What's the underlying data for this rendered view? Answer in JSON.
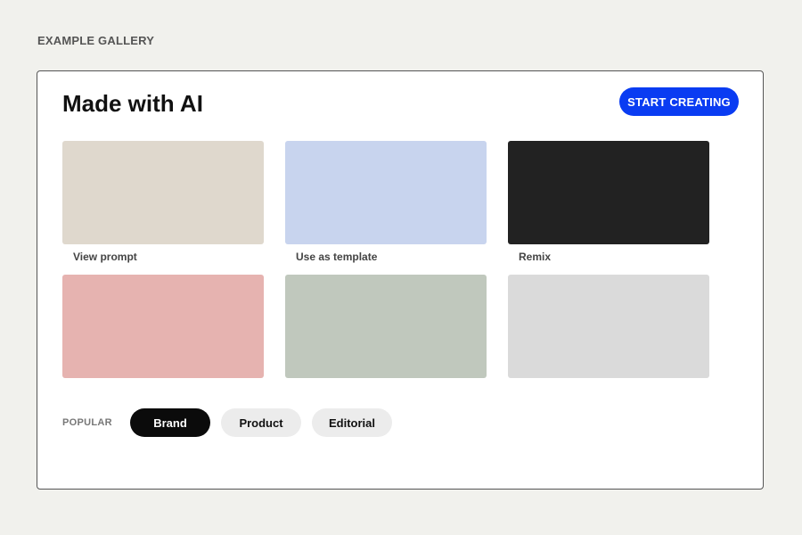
{
  "header": {
    "eyebrow": "EXAMPLE GALLERY"
  },
  "gallery": {
    "title": "Made with AI",
    "cta_label": "START CREATING",
    "tiles": [
      {
        "color": "#dfd8cd",
        "caption": "View prompt"
      },
      {
        "color": "#c8d4ee",
        "caption": "Use as template"
      },
      {
        "color": "#222222",
        "caption": "Remix"
      },
      {
        "color": "#e6b3b0",
        "caption": ""
      },
      {
        "color": "#c0c8bd",
        "caption": ""
      },
      {
        "color": "#dadada",
        "caption": ""
      }
    ]
  },
  "filters": {
    "label": "POPULAR",
    "chips": [
      {
        "label": "Brand",
        "active": true
      },
      {
        "label": "Product",
        "active": false
      },
      {
        "label": "Editorial",
        "active": false
      }
    ]
  },
  "colors": {
    "accent": "#0a3cf2",
    "background": "#f1f1ed"
  }
}
